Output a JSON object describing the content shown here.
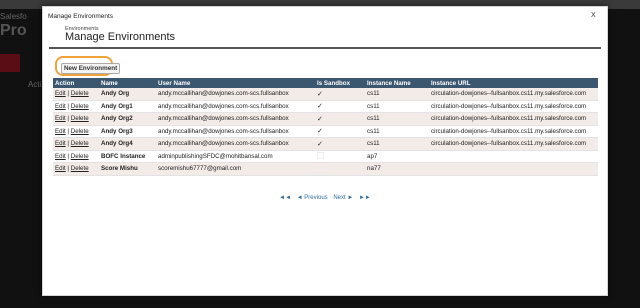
{
  "modal": {
    "title": "Manage Environments",
    "close": "X",
    "header_sub": "Environments",
    "header_title": "Manage Environments",
    "new_button": "New Environment"
  },
  "table": {
    "columns": [
      "Action",
      "Name",
      "User Name",
      "Is Sandbox",
      "Instance Name",
      "Instance URL"
    ],
    "edit_label": "Edit",
    "delete_label": "Delete",
    "sep": "|",
    "rows": [
      {
        "name": "Andy Org",
        "user": "andy.mccallihan@dowjones.com-scs.fullsanbox",
        "sandbox": true,
        "instance": "cs11",
        "url": "circulation-dowjones--fullsanbox.cs11.my.salesforce.com"
      },
      {
        "name": "Andy Org1",
        "user": "andy.mccallihan@dowjones.com-scs.fullsanbox",
        "sandbox": true,
        "instance": "cs11",
        "url": "circulation-dowjones--fullsanbox.cs11.my.salesforce.com"
      },
      {
        "name": "Andy Org2",
        "user": "andy.mccallihan@dowjones.com-scs.fullsanbox",
        "sandbox": true,
        "instance": "cs11",
        "url": "circulation-dowjones--fullsanbox.cs11.my.salesforce.com"
      },
      {
        "name": "Andy Org3",
        "user": "andy.mccallihan@dowjones.com-scs.fullsanbox",
        "sandbox": true,
        "instance": "cs11",
        "url": "circulation-dowjones--fullsanbox.cs11.my.salesforce.com"
      },
      {
        "name": "Andy Org4",
        "user": "andy.mccallihan@dowjones.com-scs.fullsanbox",
        "sandbox": true,
        "instance": "cs11",
        "url": "circulation-dowjones--fullsanbox.cs11.my.salesforce.com"
      },
      {
        "name": "BOFC Instance",
        "user": "adminpublishingSFDC@mohitbansal.com",
        "sandbox": false,
        "instance": "ap7",
        "url": ""
      },
      {
        "name": "Score Mishu",
        "user": "scoremishu67777@gmail.com",
        "sandbox": false,
        "instance": "na77",
        "url": ""
      }
    ]
  },
  "pager": {
    "first": "◄◄",
    "prev": "◄ Previous",
    "next": "Next ►",
    "last": "►►"
  },
  "background": {
    "left_small": "Salesfo",
    "left_big": "Pro",
    "left_act": "Acti"
  }
}
